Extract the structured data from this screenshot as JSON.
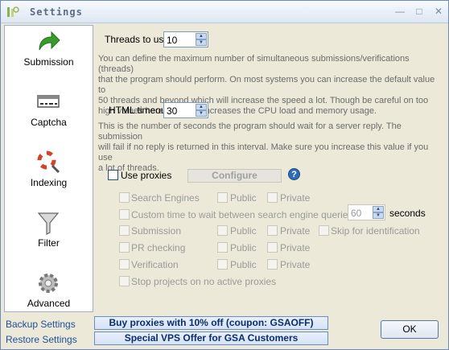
{
  "window": {
    "title": "Settings"
  },
  "sidebar": {
    "items": [
      {
        "label": "Submission",
        "icon": "green-arrow-icon"
      },
      {
        "label": "Captcha",
        "icon": "captcha-icon"
      },
      {
        "label": "Indexing",
        "icon": "lifebuoy-search-icon"
      },
      {
        "label": "Filter",
        "icon": "funnel-icon"
      },
      {
        "label": "Advanced",
        "icon": "gear-icon"
      }
    ]
  },
  "threads": {
    "label": "Threads to use",
    "value": "10",
    "desc": [
      "You can define the maximum number of simultaneous submissions/verifications (threads)",
      "that the program should perform. On most systems you can increase the default value to",
      "50 threads and beyond which will increase the speed a lot. Though be careful on too",
      "high values here as it also increases the CPU load and memory usage."
    ]
  },
  "timeout": {
    "label": "HTML timeout",
    "value": "30",
    "desc": [
      "This is the number of seconds the program should wait for a server reply. The submission",
      "will fail if no reply is returned in this interval. Make sure you increase this value if you use",
      "a lot of threads."
    ]
  },
  "proxies": {
    "use_label": "Use proxies",
    "configure_label": "Configure",
    "help": "?",
    "options": {
      "search_engines": "Search Engines",
      "public": "Public",
      "private": "Private",
      "custom_wait": "Custom time to wait between search engine queries",
      "wait_value": "60",
      "seconds": "seconds",
      "submission": "Submission",
      "skip_identification": "Skip for identification",
      "pr_checking": "PR checking",
      "verification": "Verification",
      "stop_projects": "Stop projects on no active proxies"
    }
  },
  "footer": {
    "backup": "Backup Settings",
    "restore": "Restore Settings",
    "promo1": "Buy proxies with 10% off  (coupon: GSAOFF)",
    "promo2": "Special VPS Offer for GSA Customers",
    "ok": "OK"
  }
}
